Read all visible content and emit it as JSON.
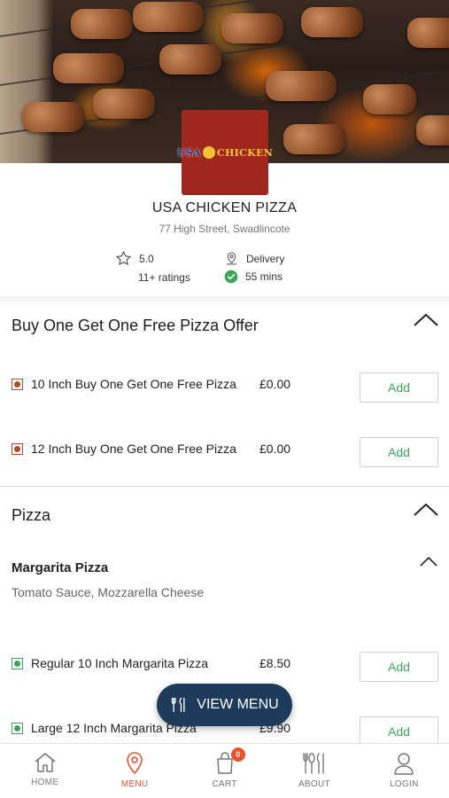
{
  "restaurant": {
    "logo_text_left": "USA",
    "logo_text_right": "CHICKEN",
    "name": "USA CHICKEN PIZZA",
    "address": "77 High Street, Swadlincote",
    "rating": "5.0",
    "ratings_count": "11+ ratings",
    "delivery_label": "Delivery",
    "delivery_time": "55 mins"
  },
  "sections": [
    {
      "title": "Buy One Get One Free Pizza Offer",
      "items": [
        {
          "name": "10 Inch Buy One Get One Free Pizza",
          "price": "£0.00",
          "button": "Add",
          "type": "non-veg"
        },
        {
          "name": "12 Inch Buy One Get One Free Pizza",
          "price": "£0.00",
          "button": "Add",
          "type": "non-veg"
        }
      ]
    },
    {
      "title": "Pizza",
      "subsection": {
        "title": "Margarita Pizza",
        "description": "Tomato Sauce, Mozzarella Cheese",
        "items": [
          {
            "name": "Regular 10 Inch Margarita Pizza",
            "price": "£8.50",
            "button": "Add",
            "type": "veg"
          },
          {
            "name": "Large 12 Inch Margarita Pizza",
            "price": "£9.90",
            "button": "Add",
            "type": "veg"
          }
        ]
      }
    }
  ],
  "fab": {
    "label": "VIEW MENU",
    "icon": "cutlery-icon"
  },
  "nav": [
    {
      "label": "HOME",
      "icon": "home-icon",
      "active": false
    },
    {
      "label": "MENU",
      "icon": "location-pin-icon",
      "active": true
    },
    {
      "label": "CART",
      "icon": "shopping-bag-icon",
      "active": false,
      "badge": "0"
    },
    {
      "label": "ABOUT",
      "icon": "cutlery-icon",
      "active": false
    },
    {
      "label": "LOGIN",
      "icon": "user-icon",
      "active": false
    }
  ],
  "colors": {
    "accent": "#e8532b",
    "add_button_text": "#3aa65a",
    "fab_bg": "#1f3b5c",
    "veg": "#3aa65a",
    "non_veg": "#b5462a",
    "logo_bg": "#a1261e"
  }
}
